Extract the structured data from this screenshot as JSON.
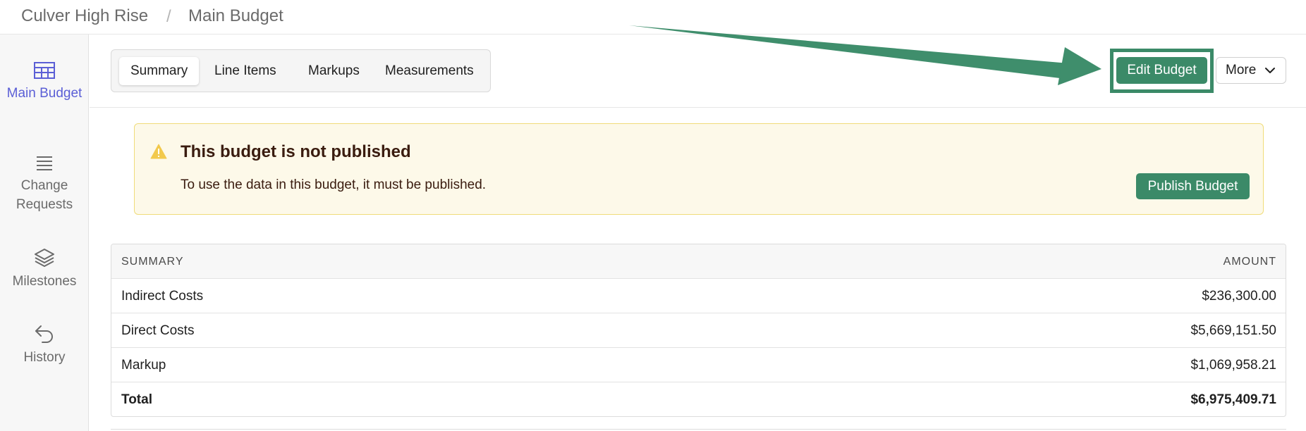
{
  "breadcrumb": {
    "project": "Culver High Rise",
    "separator": "/",
    "page": "Main Budget"
  },
  "sidebar": {
    "items": [
      {
        "label": "Main Budget",
        "icon": "table-icon",
        "active": true
      },
      {
        "label": "Change Requests",
        "icon": "list-icon",
        "active": false
      },
      {
        "label": "Milestones",
        "icon": "layers-icon",
        "active": false
      },
      {
        "label": "History",
        "icon": "undo-arrow-icon",
        "active": false
      }
    ]
  },
  "tabs": [
    {
      "label": "Summary",
      "active": true
    },
    {
      "label": "Line Items",
      "active": false
    },
    {
      "label": "Markups",
      "active": false
    },
    {
      "label": "Measurements",
      "active": false
    }
  ],
  "actions": {
    "edit_label": "Edit Budget",
    "more_label": "More"
  },
  "banner": {
    "icon": "warning-icon",
    "title": "This budget is not published",
    "text": "To use the data in this budget, it must be published.",
    "publish_label": "Publish Budget"
  },
  "summary_table": {
    "header_label": "SUMMARY",
    "header_amount": "AMOUNT",
    "rows": [
      {
        "label": "Indirect Costs",
        "amount": "$236,300.00"
      },
      {
        "label": "Direct Costs",
        "amount": "$5,669,151.50"
      },
      {
        "label": "Markup",
        "amount": "$1,069,958.21"
      }
    ],
    "total": {
      "label": "Total",
      "amount": "$6,975,409.71"
    }
  },
  "colors": {
    "accent_green": "#3b8a68",
    "active_nav": "#5b5fd6",
    "banner_bg": "#fdf9e9",
    "warning": "#f2c94c"
  }
}
